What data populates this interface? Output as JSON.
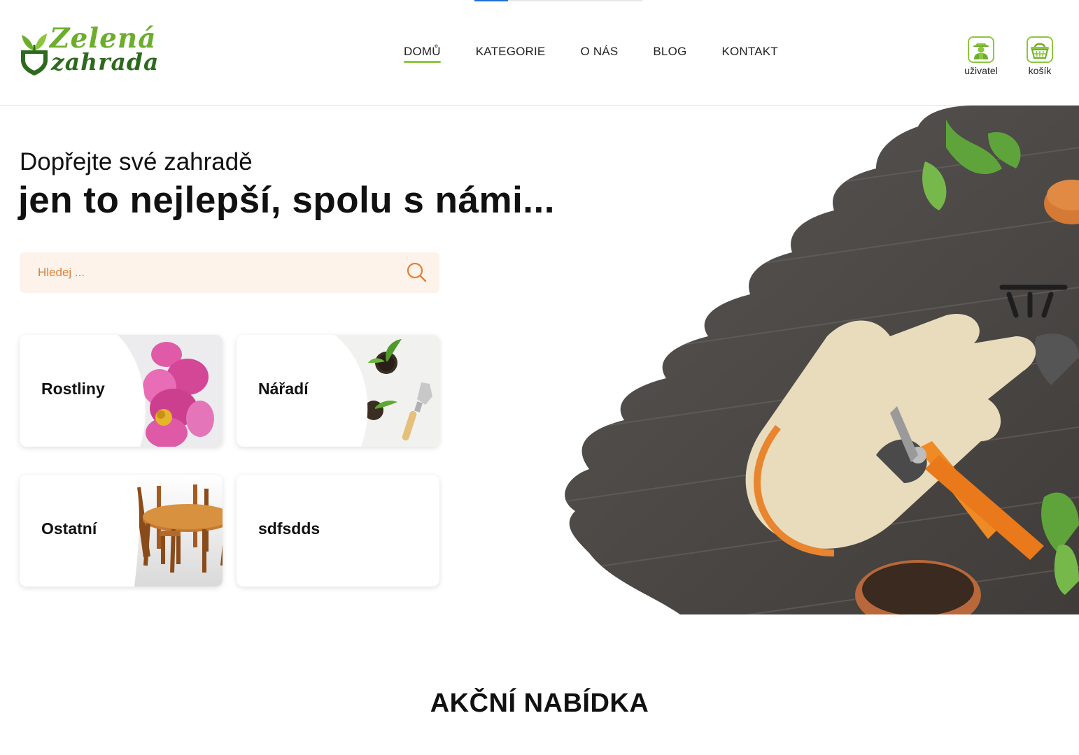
{
  "colors": {
    "accent_green": "#8cc63f",
    "logo_green_light": "#6cae2b",
    "logo_green_dark": "#2e6a1e",
    "search_bg": "#fdf3ea",
    "search_text": "#e0803a",
    "section_highlight": "#fcc99a"
  },
  "header": {
    "logo": {
      "line1": "Zelená",
      "line2": "zahrada"
    },
    "nav": [
      {
        "label": "DOMŮ",
        "active": true
      },
      {
        "label": "KATEGORIE",
        "active": false
      },
      {
        "label": "O NÁS",
        "active": false
      },
      {
        "label": "BLOG",
        "active": false
      },
      {
        "label": "KONTAKT",
        "active": false
      }
    ],
    "icons": [
      {
        "icon": "gardener-user-icon",
        "label": "uživatel"
      },
      {
        "icon": "basket-icon",
        "label": "košík"
      }
    ]
  },
  "hero": {
    "subtitle": "Dopřejte své zahradě",
    "title": "jen to nejlepší, spolu s námi...",
    "search": {
      "placeholder": "Hledej ...",
      "value": "",
      "icon": "search-icon"
    },
    "image": "gardening-gloves-pruners-tools-image"
  },
  "categories": [
    {
      "label": "Rostliny",
      "image": "peony-flower-image"
    },
    {
      "label": "Nářadí",
      "image": "seedlings-trowel-image"
    },
    {
      "label": "Ostatní",
      "image": "garden-furniture-image"
    },
    {
      "label": "sdfsdds",
      "image": ""
    }
  ],
  "promo": {
    "title": "AKČNÍ NABÍDKA"
  }
}
